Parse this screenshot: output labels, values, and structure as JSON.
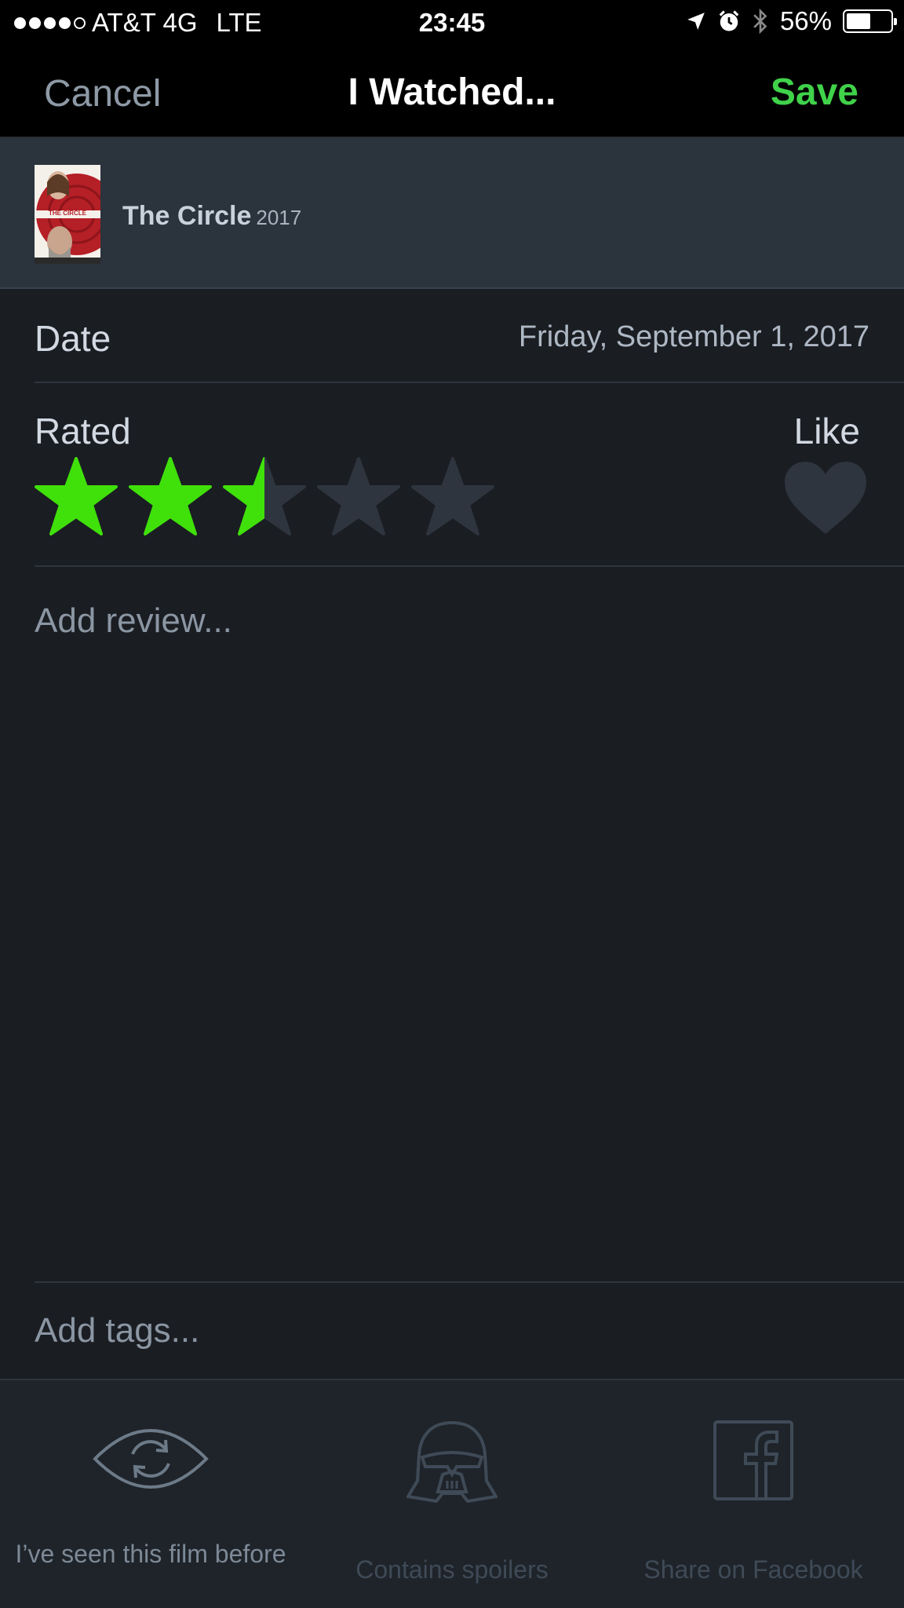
{
  "status_bar": {
    "carrier": "AT&T 4G",
    "network": "LTE",
    "time": "23:45",
    "battery": "56%",
    "battery_level": 0.56,
    "signal_dots_filled": 4,
    "signal_dots_total": 5
  },
  "nav": {
    "cancel_label": "Cancel",
    "title": "I Watched...",
    "save_label": "Save"
  },
  "film": {
    "title": "The Circle",
    "year": "2017",
    "poster_text": "THE CIRCLE"
  },
  "date": {
    "label": "Date",
    "value": "Friday, September 1, 2017"
  },
  "rating": {
    "label": "Rated",
    "stars": 2.5,
    "max_stars": 5,
    "like_label": "Like",
    "liked": false
  },
  "review": {
    "placeholder": "Add review..."
  },
  "tags": {
    "placeholder": "Add tags..."
  },
  "actions": [
    {
      "label": "I’ve seen this film before",
      "icon": "rewatch-eye-icon",
      "enabled": true
    },
    {
      "label": "Contains spoilers",
      "icon": "darth-vader-helmet-icon",
      "enabled": false
    },
    {
      "label": "Share on Facebook",
      "icon": "facebook-icon",
      "enabled": false
    }
  ],
  "colors": {
    "accent": "#40d24a",
    "star_on": "#40e00a",
    "star_off": "#2e353e",
    "background": "#1a1d22",
    "film_row": "#2b333d"
  }
}
